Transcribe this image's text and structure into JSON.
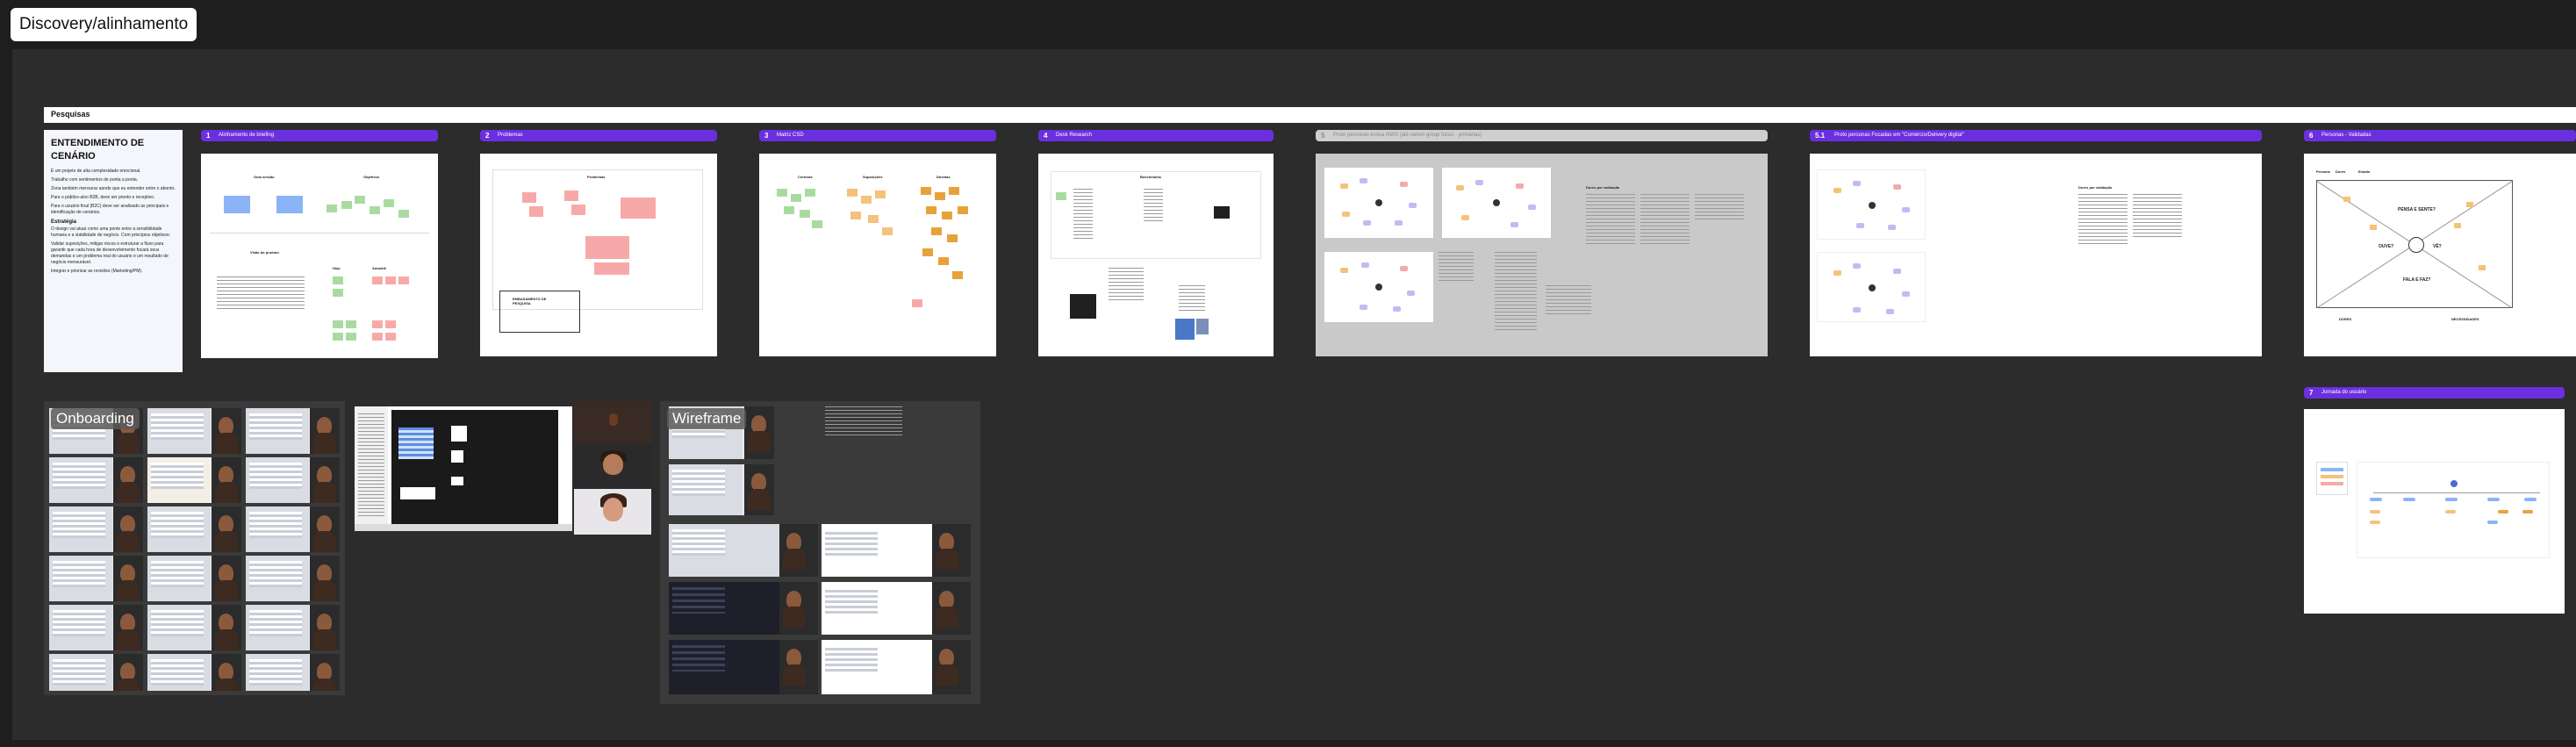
{
  "document": {
    "title": "Discovery/alinhamento"
  },
  "section": {
    "label": "Pesquisas"
  },
  "intro": {
    "heading": "ENTENDIMENTO DE CENÁRIO",
    "paragraphs": [
      "É um projeto de alta complexidade emocional.",
      "Trabalho com sentimentos de ponta a ponta.",
      "Zona também mensurar aonde que eu entender entre o abordo.",
      "Para o público-alvo B2B, deve ser pronto e receptivo.",
      "Para o usuário final (B2C) deve ser analisado as principais e identificação de cenários."
    ],
    "strategy_heading": "Estratégia",
    "strategy_text": "O design vai atuar como uma ponte entre a sensibilidade humana e a viabilidade de negócio. Com princípios objetivos:",
    "strategy_items": [
      "Validar suposições, mitigar riscos e estruturar a fluxo para garantir que cada hora de desenvolvimento focará seus demandas e um problema real do usuário e um resultado de negócio mensurável.",
      "Integrar e priorizar as revisões (Marketing/PM)."
    ]
  },
  "frames": [
    {
      "num": "1",
      "label": "Alinhamento de briefing",
      "titles": [
        "Guia sessão",
        "Objetivos",
        "Visão do produto",
        "Hoje",
        "Amanhã"
      ]
    },
    {
      "num": "2",
      "label": "Problemas",
      "titles": [
        "Problemas",
        "EMBASAMENTO DE PESQUISA"
      ]
    },
    {
      "num": "3",
      "label": "Matriz CSD",
      "titles": [
        "Certezas",
        "Suposições",
        "Dúvidas"
      ]
    },
    {
      "num": "4",
      "label": "Desk Research",
      "titles": [
        "Benchmarks"
      ]
    },
    {
      "num": "5",
      "label": "Proto personas evoca NWS (até serem group focus - primárias)",
      "titles": [
        "Dores por validação"
      ]
    },
    {
      "num": "5.1",
      "label": "Proto personas Focadas em \"Comércio/Delivery digital\"",
      "titles": [
        "Dores por validação"
      ]
    },
    {
      "num": "6",
      "label": "Personas - Validadas",
      "titles": [
        "Persona",
        "Dores",
        "Estado",
        "PENSA E SENTE?",
        "OUVE?",
        "VÊ?",
        "FALA E FAZ?",
        "DORES",
        "NECESSIDADES"
      ]
    },
    {
      "num": "7",
      "label": "Jornada do usuário",
      "titles": []
    }
  ],
  "groups": [
    {
      "label": "Onboarding"
    },
    {
      "label": "Wireframe"
    }
  ],
  "icons": {
    "participant": "person-video-icon",
    "mindmap": "mindmap-icon"
  },
  "colors": {
    "accent": "#6b2fe0",
    "canvas": "#1e1e1e",
    "frame_area": "#2c2c2c"
  }
}
